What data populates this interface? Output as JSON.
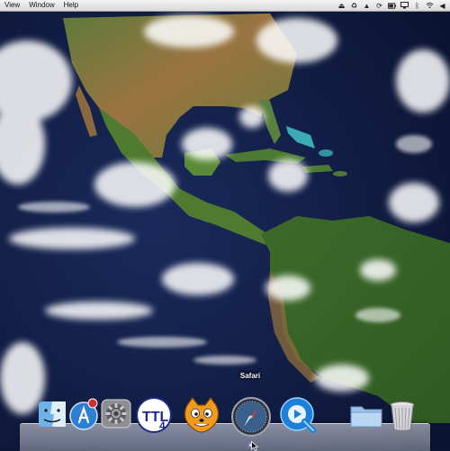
{
  "menubar": {
    "items": [
      "View",
      "Window",
      "Help"
    ]
  },
  "status_icons": [
    "eject-icon",
    "recycle-icon",
    "adobe-icon",
    "sync-icon",
    "battery-icon",
    "monitor-icon",
    "bluetooth-icon",
    "wifi-icon",
    "volume-icon"
  ],
  "dock": {
    "tooltip": "Safari",
    "items": [
      {
        "name": "finder",
        "icon": "finder-icon"
      },
      {
        "name": "app-store",
        "icon": "app-store-icon",
        "badge": true
      },
      {
        "name": "system-preferences",
        "icon": "gear-icon"
      },
      {
        "name": "ttl4",
        "icon": "ttl4-icon",
        "label": "TTL4"
      },
      {
        "name": "scratch",
        "icon": "scratch-cat-icon"
      },
      {
        "name": "safari",
        "icon": "safari-compass-icon"
      },
      {
        "name": "quicktime",
        "icon": "quicktime-icon"
      },
      {
        "name": "applications-folder",
        "icon": "folder-icon"
      },
      {
        "name": "trash",
        "icon": "trash-icon"
      }
    ]
  },
  "colors": {
    "ocean": "#0f1d45",
    "land_green": "#3f6b2a",
    "land_desert": "#8a6a3c",
    "reef": "#3fc4c9"
  }
}
